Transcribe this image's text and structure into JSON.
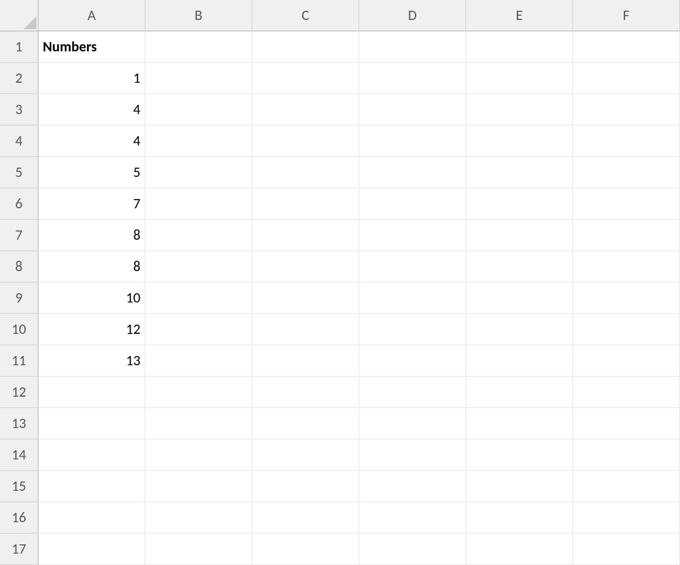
{
  "columns": [
    "A",
    "B",
    "C",
    "D",
    "E",
    "F"
  ],
  "rowCount": 17,
  "cells": {
    "A1": {
      "value": "Numbers",
      "bold": true,
      "align": "left"
    },
    "A2": {
      "value": "1",
      "align": "right"
    },
    "A3": {
      "value": "4",
      "align": "right"
    },
    "A4": {
      "value": "4",
      "align": "right"
    },
    "A5": {
      "value": "5",
      "align": "right"
    },
    "A6": {
      "value": "7",
      "align": "right"
    },
    "A7": {
      "value": "8",
      "align": "right"
    },
    "A8": {
      "value": "8",
      "align": "right"
    },
    "A9": {
      "value": "10",
      "align": "right"
    },
    "A10": {
      "value": "12",
      "align": "right"
    },
    "A11": {
      "value": "13",
      "align": "right"
    }
  }
}
